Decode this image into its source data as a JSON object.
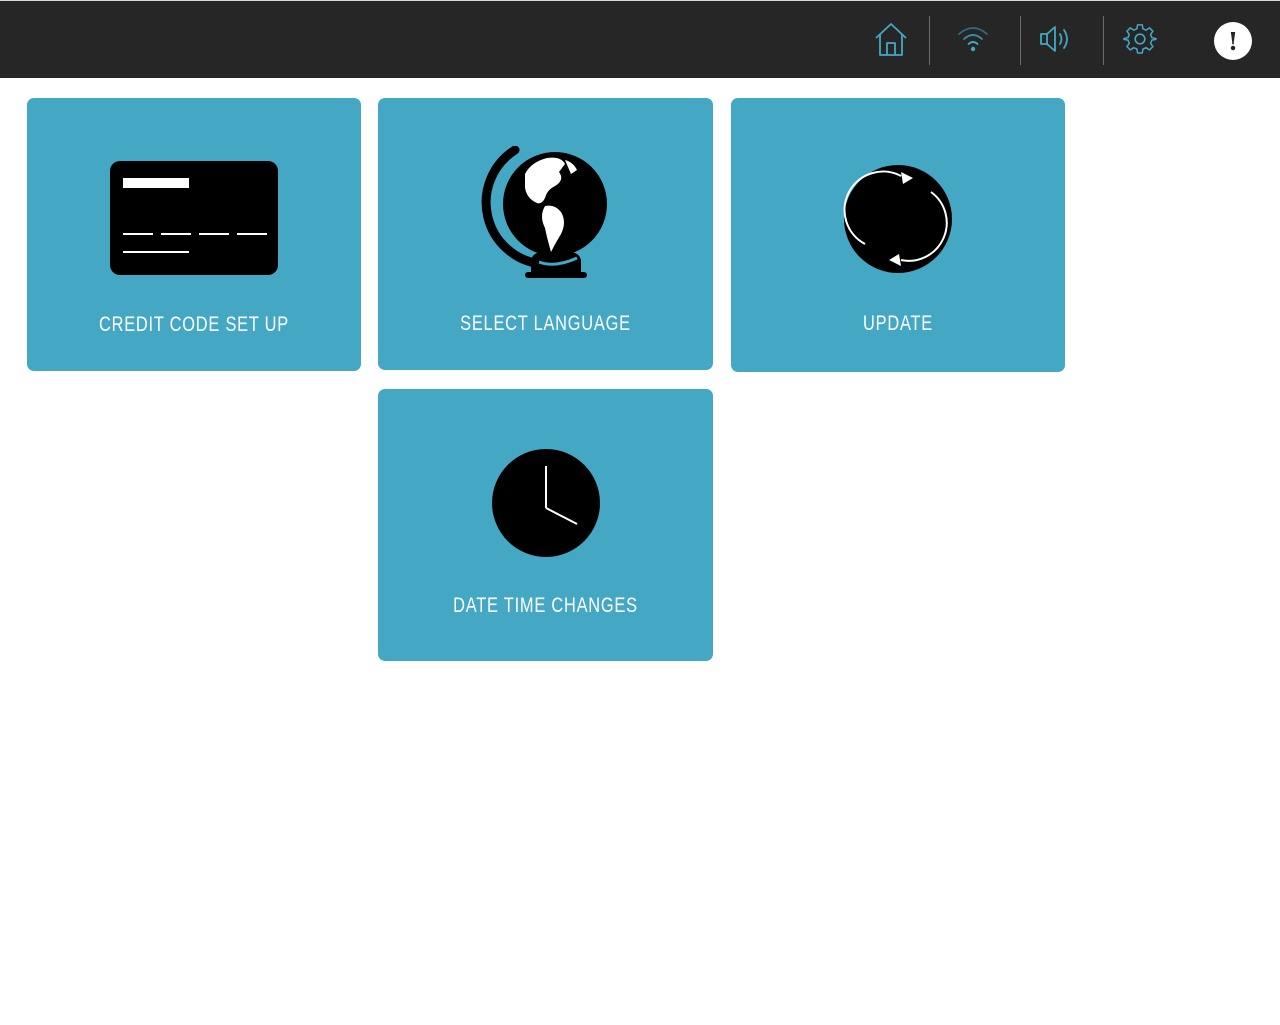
{
  "topbar": {
    "icons": [
      {
        "name": "home-icon",
        "color": "#44a8c4"
      },
      {
        "name": "wifi-icon",
        "color": "#44a8c4"
      },
      {
        "name": "volume-icon",
        "color": "#44a8c4"
      },
      {
        "name": "settings-gear-icon",
        "color": "#44a8c4"
      }
    ],
    "alert_label": "!"
  },
  "tiles": [
    {
      "id": "credit-code-setup",
      "label": "CREDIT CODE SET UP",
      "icon": "credit-card-icon"
    },
    {
      "id": "select-language",
      "label": "SELECT LANGUAGE",
      "icon": "globe-icon"
    },
    {
      "id": "update",
      "label": "UPDATE",
      "icon": "refresh-icon"
    },
    {
      "id": "date-time-changes",
      "label": "DATE TIME CHANGES",
      "icon": "clock-icon"
    }
  ],
  "colors": {
    "topbar_bg": "#272627",
    "tile_bg": "#44a8c4",
    "icon_accent": "#44a8c4",
    "tile_text": "#ffffff"
  }
}
